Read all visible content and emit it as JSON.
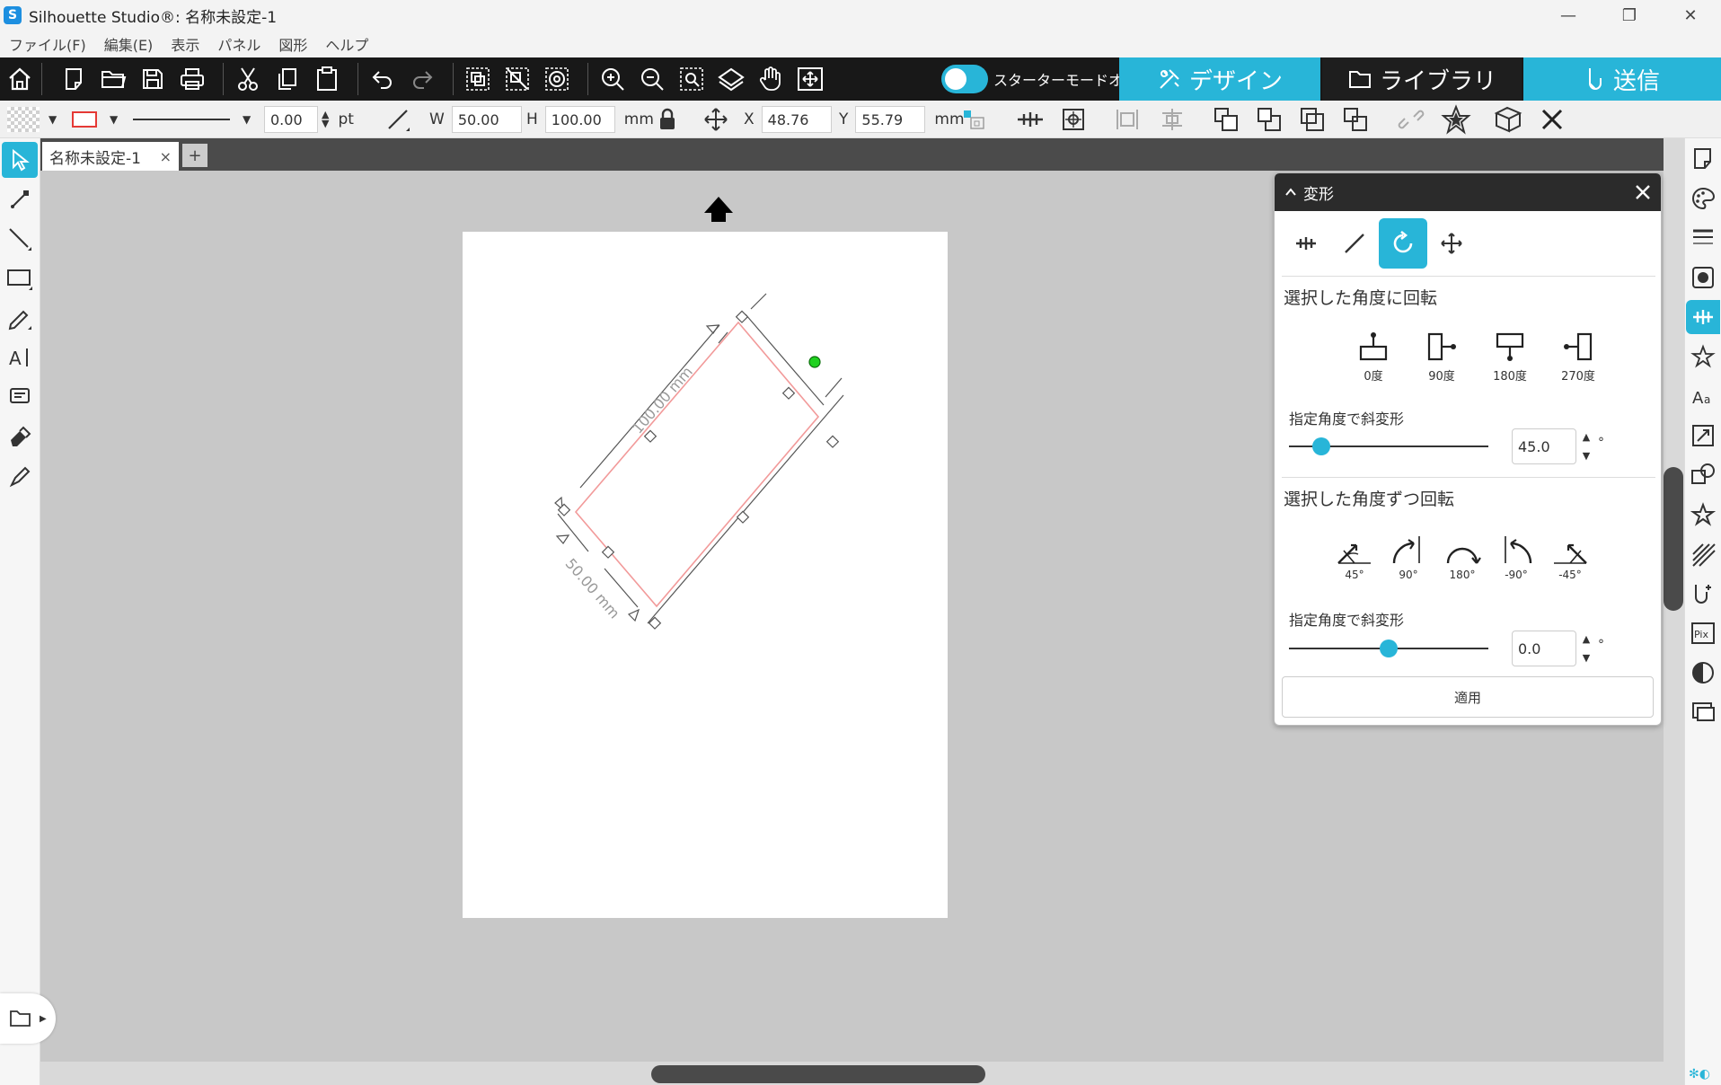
{
  "window": {
    "title": "Silhouette Studio®: 名称未設定-1",
    "minimize": "—",
    "maximize": "❐",
    "close": "✕"
  },
  "menu": [
    "ファイル(F)",
    "編集(E)",
    "表示",
    "パネル",
    "図形",
    "ヘルプ"
  ],
  "main_toolbar": {
    "starter_mode": "スターターモードオフ",
    "tabs": {
      "design": "デザイン",
      "library": "ライブラリ",
      "send": "送信"
    },
    "colors": {
      "bar": "#181818",
      "accent": "#28b5d8",
      "library_tab": "#1e1e1e"
    }
  },
  "properties": {
    "line_width": "0.00",
    "line_unit": "pt",
    "w_label": "W",
    "w_value": "50.00",
    "h_label": "H",
    "h_value": "100.00",
    "size_unit": "mm",
    "x_label": "X",
    "x_value": "48.76",
    "y_label": "Y",
    "y_value": "55.79",
    "pos_unit": "mm"
  },
  "document": {
    "tab_name": "名称未設定-1",
    "tab_close": "×",
    "tab_add": "+",
    "dim_long": "100.00 mm",
    "dim_short": "50.00 mm"
  },
  "transform_panel": {
    "title": "変形",
    "section_rotate_to": "選択した角度に回転",
    "rotate_to": [
      "0度",
      "90度",
      "180度",
      "270度"
    ],
    "shear_label_1": "指定角度で斜変形",
    "shear_value_1": "45.0",
    "section_rotate_by": "選択した角度ずつ回転",
    "rotate_by": [
      "45°",
      "90°",
      "180°",
      "-90°",
      "-45°"
    ],
    "shear_label_2": "指定角度で斜変形",
    "shear_value_2": "0.0",
    "degree_symbol": "°",
    "apply": "適用",
    "slider_1_fraction": 0.16,
    "slider_2_fraction": 0.5
  }
}
